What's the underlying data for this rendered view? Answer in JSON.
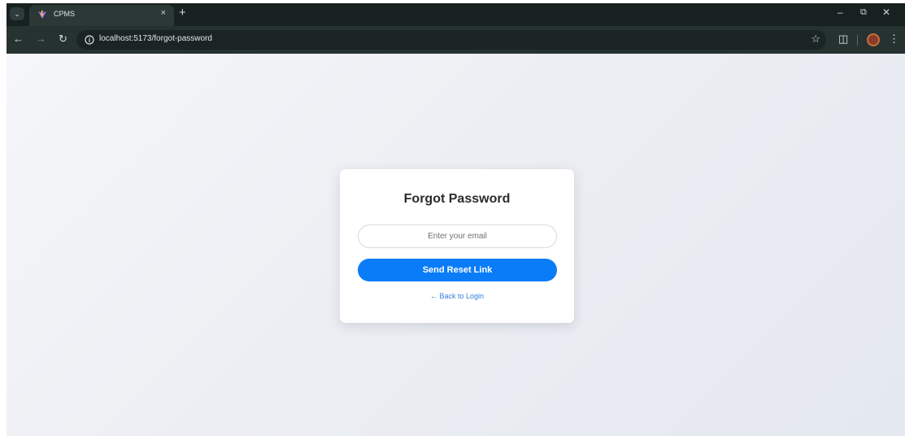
{
  "browser": {
    "tab_title": "CPMS",
    "url": "localhost:5173/forgot-password"
  },
  "page": {
    "title": "Forgot Password",
    "email_placeholder": "Enter your email",
    "email_value": "",
    "submit_label": "Send Reset Link",
    "back_link_label": "← Back to Login"
  },
  "colors": {
    "primary_button": "#0a7cf8",
    "link": "#2f7fd8",
    "browser_frame": "#17211f"
  },
  "icons": {
    "tab_menu": "chevron-down-icon",
    "favicon": "vite-logo-icon",
    "close_tab": "close-icon",
    "new_tab": "plus-icon",
    "back": "arrow-left-icon",
    "forward": "arrow-right-icon",
    "reload": "reload-icon",
    "site_info": "info-icon",
    "bookmark": "star-icon",
    "extensions": "puzzle-icon",
    "profile": "avatar",
    "menu": "kebab-icon"
  }
}
